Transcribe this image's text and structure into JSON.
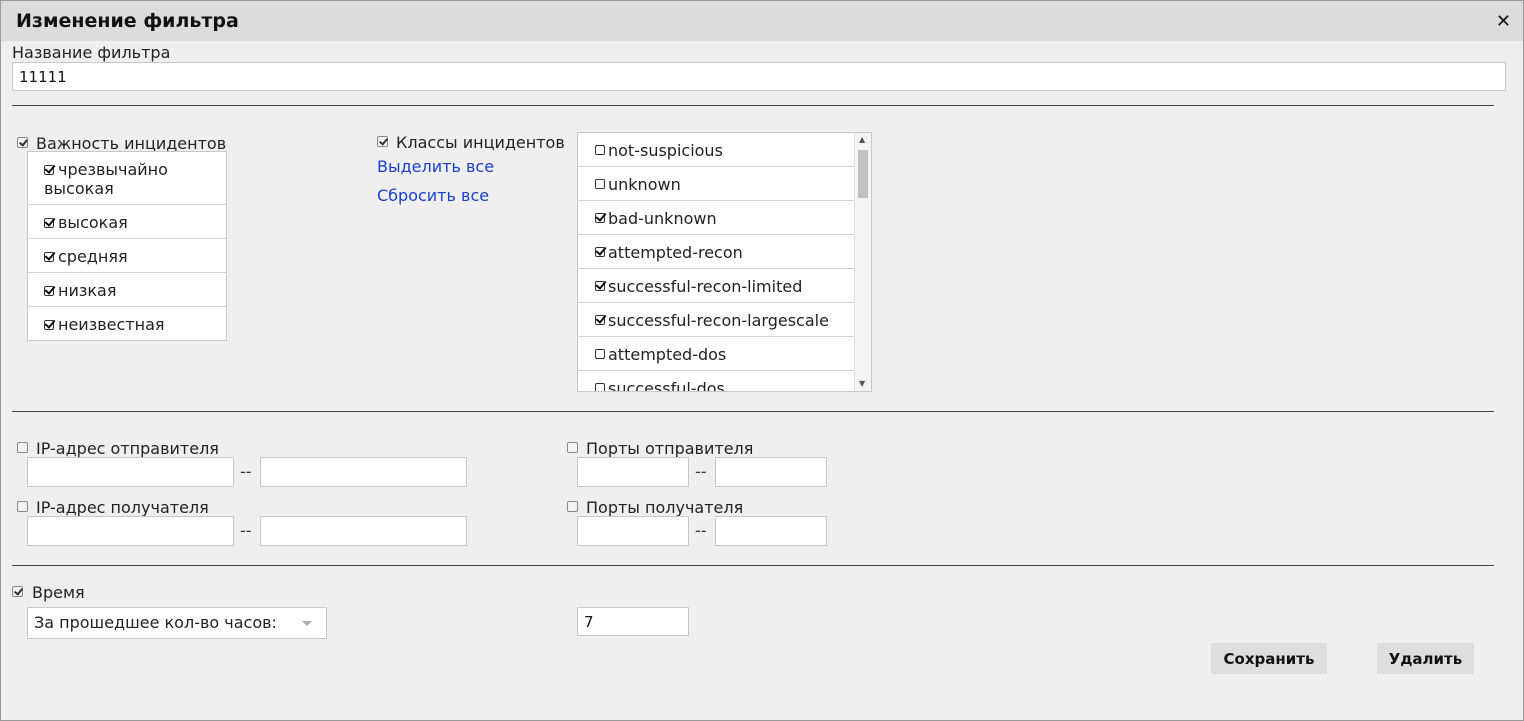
{
  "dialog": {
    "title": "Изменение фильтра",
    "close_icon": "close-icon",
    "close_glyph": "✕"
  },
  "filter_name": {
    "label": "Название фильтра",
    "value": "11111"
  },
  "severity": {
    "label": "Важность инцидентов",
    "checked": true,
    "items": [
      {
        "label": "чрезвычайно высокая",
        "checked": true
      },
      {
        "label": "высокая",
        "checked": true
      },
      {
        "label": "средняя",
        "checked": true
      },
      {
        "label": "низкая",
        "checked": true
      },
      {
        "label": "неизвестная",
        "checked": true
      }
    ]
  },
  "classes": {
    "label": "Классы инцидентов",
    "checked": true,
    "select_all": "Выделить все",
    "reset_all": "Сбросить все",
    "items": [
      {
        "label": "not-suspicious",
        "checked": false
      },
      {
        "label": "unknown",
        "checked": false
      },
      {
        "label": "bad-unknown",
        "checked": true
      },
      {
        "label": "attempted-recon",
        "checked": true
      },
      {
        "label": "successful-recon-limited",
        "checked": true
      },
      {
        "label": "successful-recon-largescale",
        "checked": true
      },
      {
        "label": "attempted-dos",
        "checked": false
      },
      {
        "label": "successful-dos",
        "checked": false
      }
    ]
  },
  "network": {
    "src_ip": {
      "label": "IP-адрес отправителя",
      "checked": false,
      "from": "",
      "to": ""
    },
    "dst_ip": {
      "label": "IP-адрес получателя",
      "checked": false,
      "from": "",
      "to": ""
    },
    "src_ports": {
      "label": "Порты отправителя",
      "checked": false,
      "from": "",
      "to": ""
    },
    "dst_ports": {
      "label": "Порты получателя",
      "checked": false,
      "from": "",
      "to": ""
    },
    "range_separator": "--"
  },
  "time": {
    "label": "Время",
    "checked": true,
    "mode": "За прошедшее кол-во часов:",
    "value": "7"
  },
  "buttons": {
    "save": "Сохранить",
    "delete": "Удалить"
  }
}
